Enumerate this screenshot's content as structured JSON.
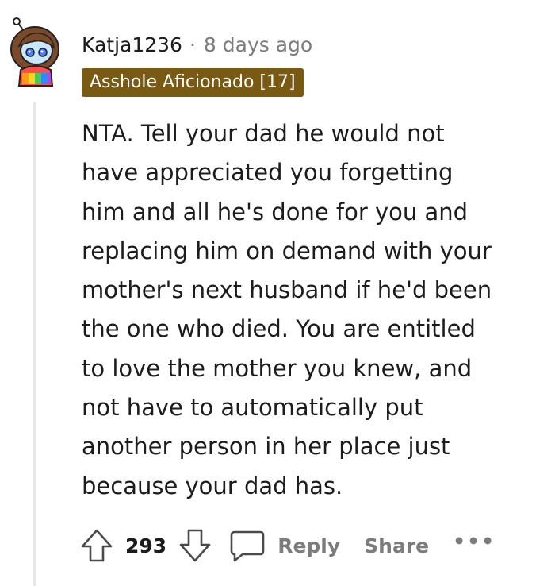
{
  "comment": {
    "author": "Katja1236",
    "separator": "·",
    "timestamp": "8 days ago",
    "flair": "Asshole Aficionado [17]",
    "body_lines": [
      "NTA. Tell your dad he would not",
      "have appreciated you forgetting",
      "him and all he's done for you and",
      "replacing him on demand with your",
      "mother's next husband if he'd been",
      "the one who died. You are entitled",
      "to love the mother you knew, and",
      "not have to automatically put",
      "another person in her place just",
      "because your dad has."
    ]
  },
  "actions": {
    "upvote_icon": "arrow-up-icon",
    "score": "293",
    "downvote_icon": "arrow-down-icon",
    "reply_icon": "speech-bubble-icon",
    "reply_label": "Reply",
    "share_label": "Share",
    "more_label": "•••"
  },
  "colors": {
    "flair_bg": "#7a5a12",
    "text": "#1c1c1c",
    "muted": "#7c7c7c"
  }
}
